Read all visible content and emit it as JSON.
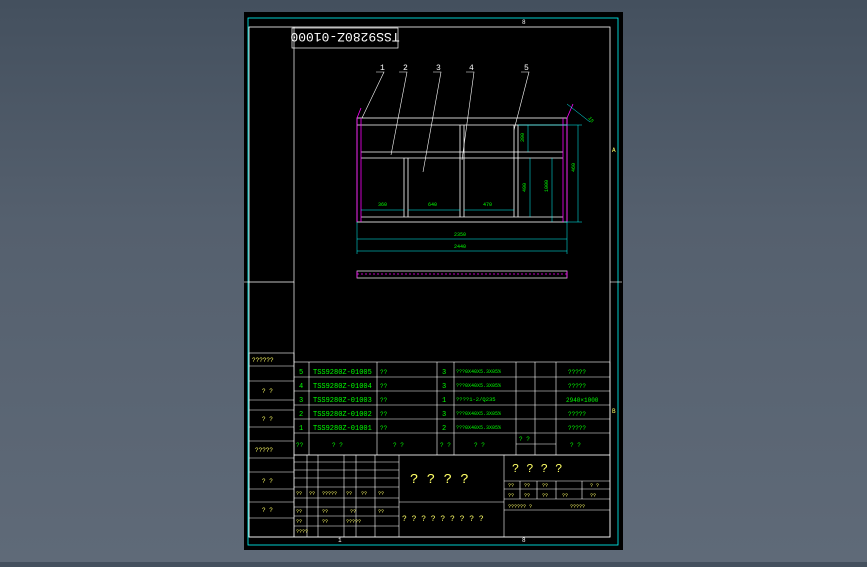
{
  "drawing_number": "TSS9280Z-01000",
  "border": {
    "top": [
      "8"
    ],
    "bottom": [
      "1",
      "8"
    ],
    "right": [
      "A",
      "B"
    ]
  },
  "balloons": [
    "1",
    "2",
    "3",
    "4",
    "5"
  ],
  "dimensions": {
    "d1": "360",
    "d2": "640",
    "d3": "470",
    "d4": "2350",
    "d5": "2440",
    "h1": "390",
    "h2": "490",
    "h3": "1000",
    "h4": "460",
    "angle": "15"
  },
  "left_strip": [
    "??????",
    "? ?",
    "? ?",
    "?????",
    "? ?",
    "? ?"
  ],
  "bom_rows": [
    {
      "no": "5",
      "code": "TSS9280Z-01005",
      "name": "??",
      "qty": "3",
      "spec": "???0X40X5.3X05%",
      "note": "?????"
    },
    {
      "no": "4",
      "code": "TSS9280Z-01004",
      "name": "??",
      "qty": "3",
      "spec": "???0X40X5.3X05%",
      "note": "?????"
    },
    {
      "no": "3",
      "code": "TSS9280Z-01003",
      "name": "??",
      "qty": "1",
      "spec": "????1-2/Q235",
      "note": "2940×1000"
    },
    {
      "no": "2",
      "code": "TSS9280Z-01002",
      "name": "??",
      "qty": "3",
      "spec": "???0X40X5.3X05%",
      "note": "?????"
    },
    {
      "no": "1",
      "code": "TSS9280Z-01001",
      "name": "??",
      "qty": "2",
      "spec": "???0X40X5.3X05%",
      "note": "?????"
    }
  ],
  "bom_header": {
    "col1": "??",
    "col2": "? ?",
    "col3": "? ?",
    "col4": "? ?",
    "col5": "? ?",
    "col6": "? ?",
    "col7": "? ?"
  },
  "title_block": {
    "main_title": "? ? ? ?",
    "right_title": "? ? ? ?",
    "company": "? ? ? ? ? ? ? ? ?",
    "cells_left": [
      "??",
      "??",
      "?????",
      "??",
      "??",
      "??",
      "??",
      "??",
      "??",
      "??",
      "??",
      "??",
      "?????",
      "????"
    ],
    "cells_right": [
      "??",
      "??",
      "??",
      "? ?",
      "??",
      "??",
      "??",
      "??",
      "??",
      "?????? ?",
      "?????"
    ]
  }
}
